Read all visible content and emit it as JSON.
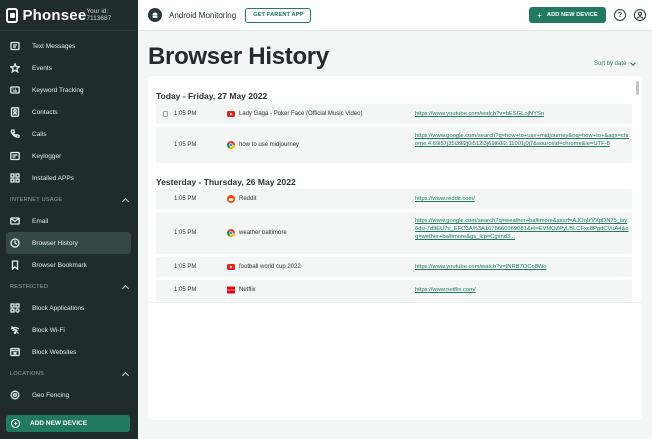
{
  "brand": {
    "name": "Phonsee",
    "user_id": "Your id: 7113687"
  },
  "sidebar": {
    "main_items": [
      {
        "label": "Text Messages",
        "icon": "message-icon"
      },
      {
        "label": "Events",
        "icon": "star-icon"
      },
      {
        "label": "Keyword Tracking",
        "icon": "keyboard-icon"
      },
      {
        "label": "Contacts",
        "icon": "contact-card-icon"
      },
      {
        "label": "Calls",
        "icon": "phone-icon"
      },
      {
        "label": "Keylogger",
        "icon": "keylogger-icon"
      },
      {
        "label": "Installed APPs",
        "icon": "apps-grid-icon"
      }
    ],
    "internet_usage": {
      "heading": "INTERNET USAGE",
      "items": [
        {
          "label": "Email",
          "icon": "mail-icon"
        },
        {
          "label": "Browser History",
          "icon": "clock-icon",
          "active": true
        },
        {
          "label": "Browser Bookmark",
          "icon": "bookmark-icon"
        }
      ]
    },
    "restricted": {
      "heading": "RESTRICTED",
      "items": [
        {
          "label": "Block Applications",
          "icon": "block-apps-icon"
        },
        {
          "label": "Block Wi-Fi",
          "icon": "wifi-off-icon"
        },
        {
          "label": "Block Websites",
          "icon": "block-web-icon"
        }
      ]
    },
    "locations": {
      "heading": "LOCATIONS",
      "items": [
        {
          "label": "Geo Fencing",
          "icon": "geofence-icon"
        }
      ]
    },
    "add_device_label": "ADD NEW DEVICE"
  },
  "topbar": {
    "title": "Android Monitoring",
    "parent_app_label": "GET PARENT APP",
    "add_device_label": "ADD NEW DEVICE",
    "help_glyph": "?"
  },
  "main": {
    "title": "Browser History",
    "sort_label": "Sort by date",
    "groups": [
      {
        "heading": "Today - Friday, 27 May 2022",
        "entries": [
          {
            "time": "1:05 PM",
            "site": "youtube",
            "title": "Lady Gaga - Poker Face (Official Music Video)",
            "url": "https://www.youtube.com/watch?v=bESGLojNYSo"
          },
          {
            "time": "1:05 PM",
            "site": "google",
            "title": "how to use midjourney",
            "url": "https://www.google.com/search?q=how+to+use+midjourney&oq=how+to+&aqs=chrome.4.69i57j35i39l2j0i512l3j69i60l2.11001j0j7&sourceid=chrome&ie=UTF-8"
          }
        ]
      },
      {
        "heading": "Yesterday - Thursday, 26 May 2022",
        "entries": [
          {
            "time": "1:05 PM",
            "site": "reddit",
            "title": "Reddit",
            "url": "https://www.reddit.com/"
          },
          {
            "time": "1:05 PM",
            "site": "google",
            "title": "weather baltimore",
            "url": "https://www.google.com/search?q=weather+baltimore&sxsrf=AJOqlzVXpDN75_lsy6du-7d9EU7v_EFO3A%3A1678660369081&ei=EVMOZPyLBLCFxc8PgdCVuA4&oq=wether+baltimore&gs_lcp=Cgxnd3..."
          },
          {
            "time": "1:05 PM",
            "site": "youtube",
            "title": "football world cup 2022",
            "url": "https://www.youtube.com/watch?v=INRB7OCo8Wo"
          },
          {
            "time": "1:05 PM",
            "site": "netflix",
            "title": "Netflix",
            "url": "https://www.netflix.com/"
          }
        ]
      }
    ]
  },
  "colors": {
    "accent": "#217a60",
    "sidebar_bg": "#202b2e",
    "youtube": "#e62117",
    "reddit": "#ff4500",
    "netflix": "#e50914"
  }
}
